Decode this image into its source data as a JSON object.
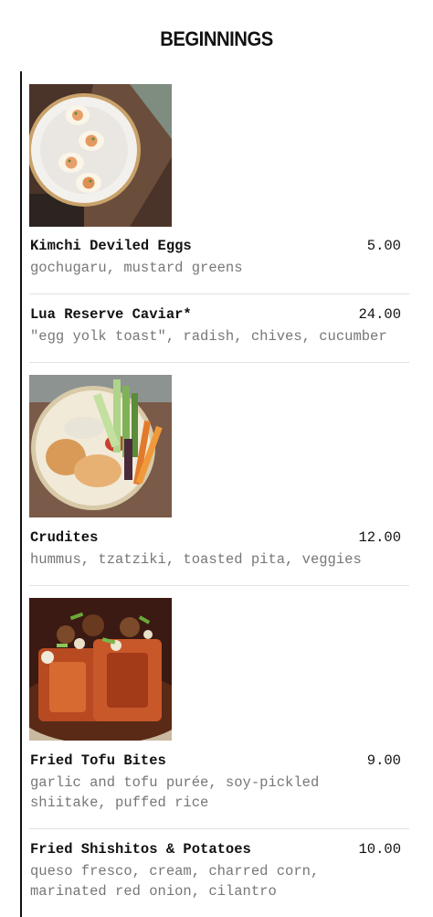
{
  "section": {
    "title": "BEGINNINGS"
  },
  "items": [
    {
      "name": "Kimchi Deviled Eggs",
      "price": "5.00",
      "desc": "gochugaru, mustard greens",
      "image": "deviled-eggs-photo"
    },
    {
      "name": "Lua Reserve Caviar*",
      "price": "24.00",
      "desc": "\"egg yolk toast\", radish, chives, cucumber",
      "image": null
    },
    {
      "name": "Crudites",
      "price": "12.00",
      "desc": "hummus, tzatziki, toasted pita, veggies",
      "image": "crudites-photo"
    },
    {
      "name": "Fried Tofu Bites",
      "price": "9.00",
      "desc": "garlic and tofu purée, soy-pickled shiitake, puffed rice",
      "image": "tofu-photo"
    },
    {
      "name": "Fried Shishitos & Potatoes",
      "price": "10.00",
      "desc": "queso fresco, cream, charred corn, marinated red onion, cilantro",
      "image": null
    }
  ]
}
